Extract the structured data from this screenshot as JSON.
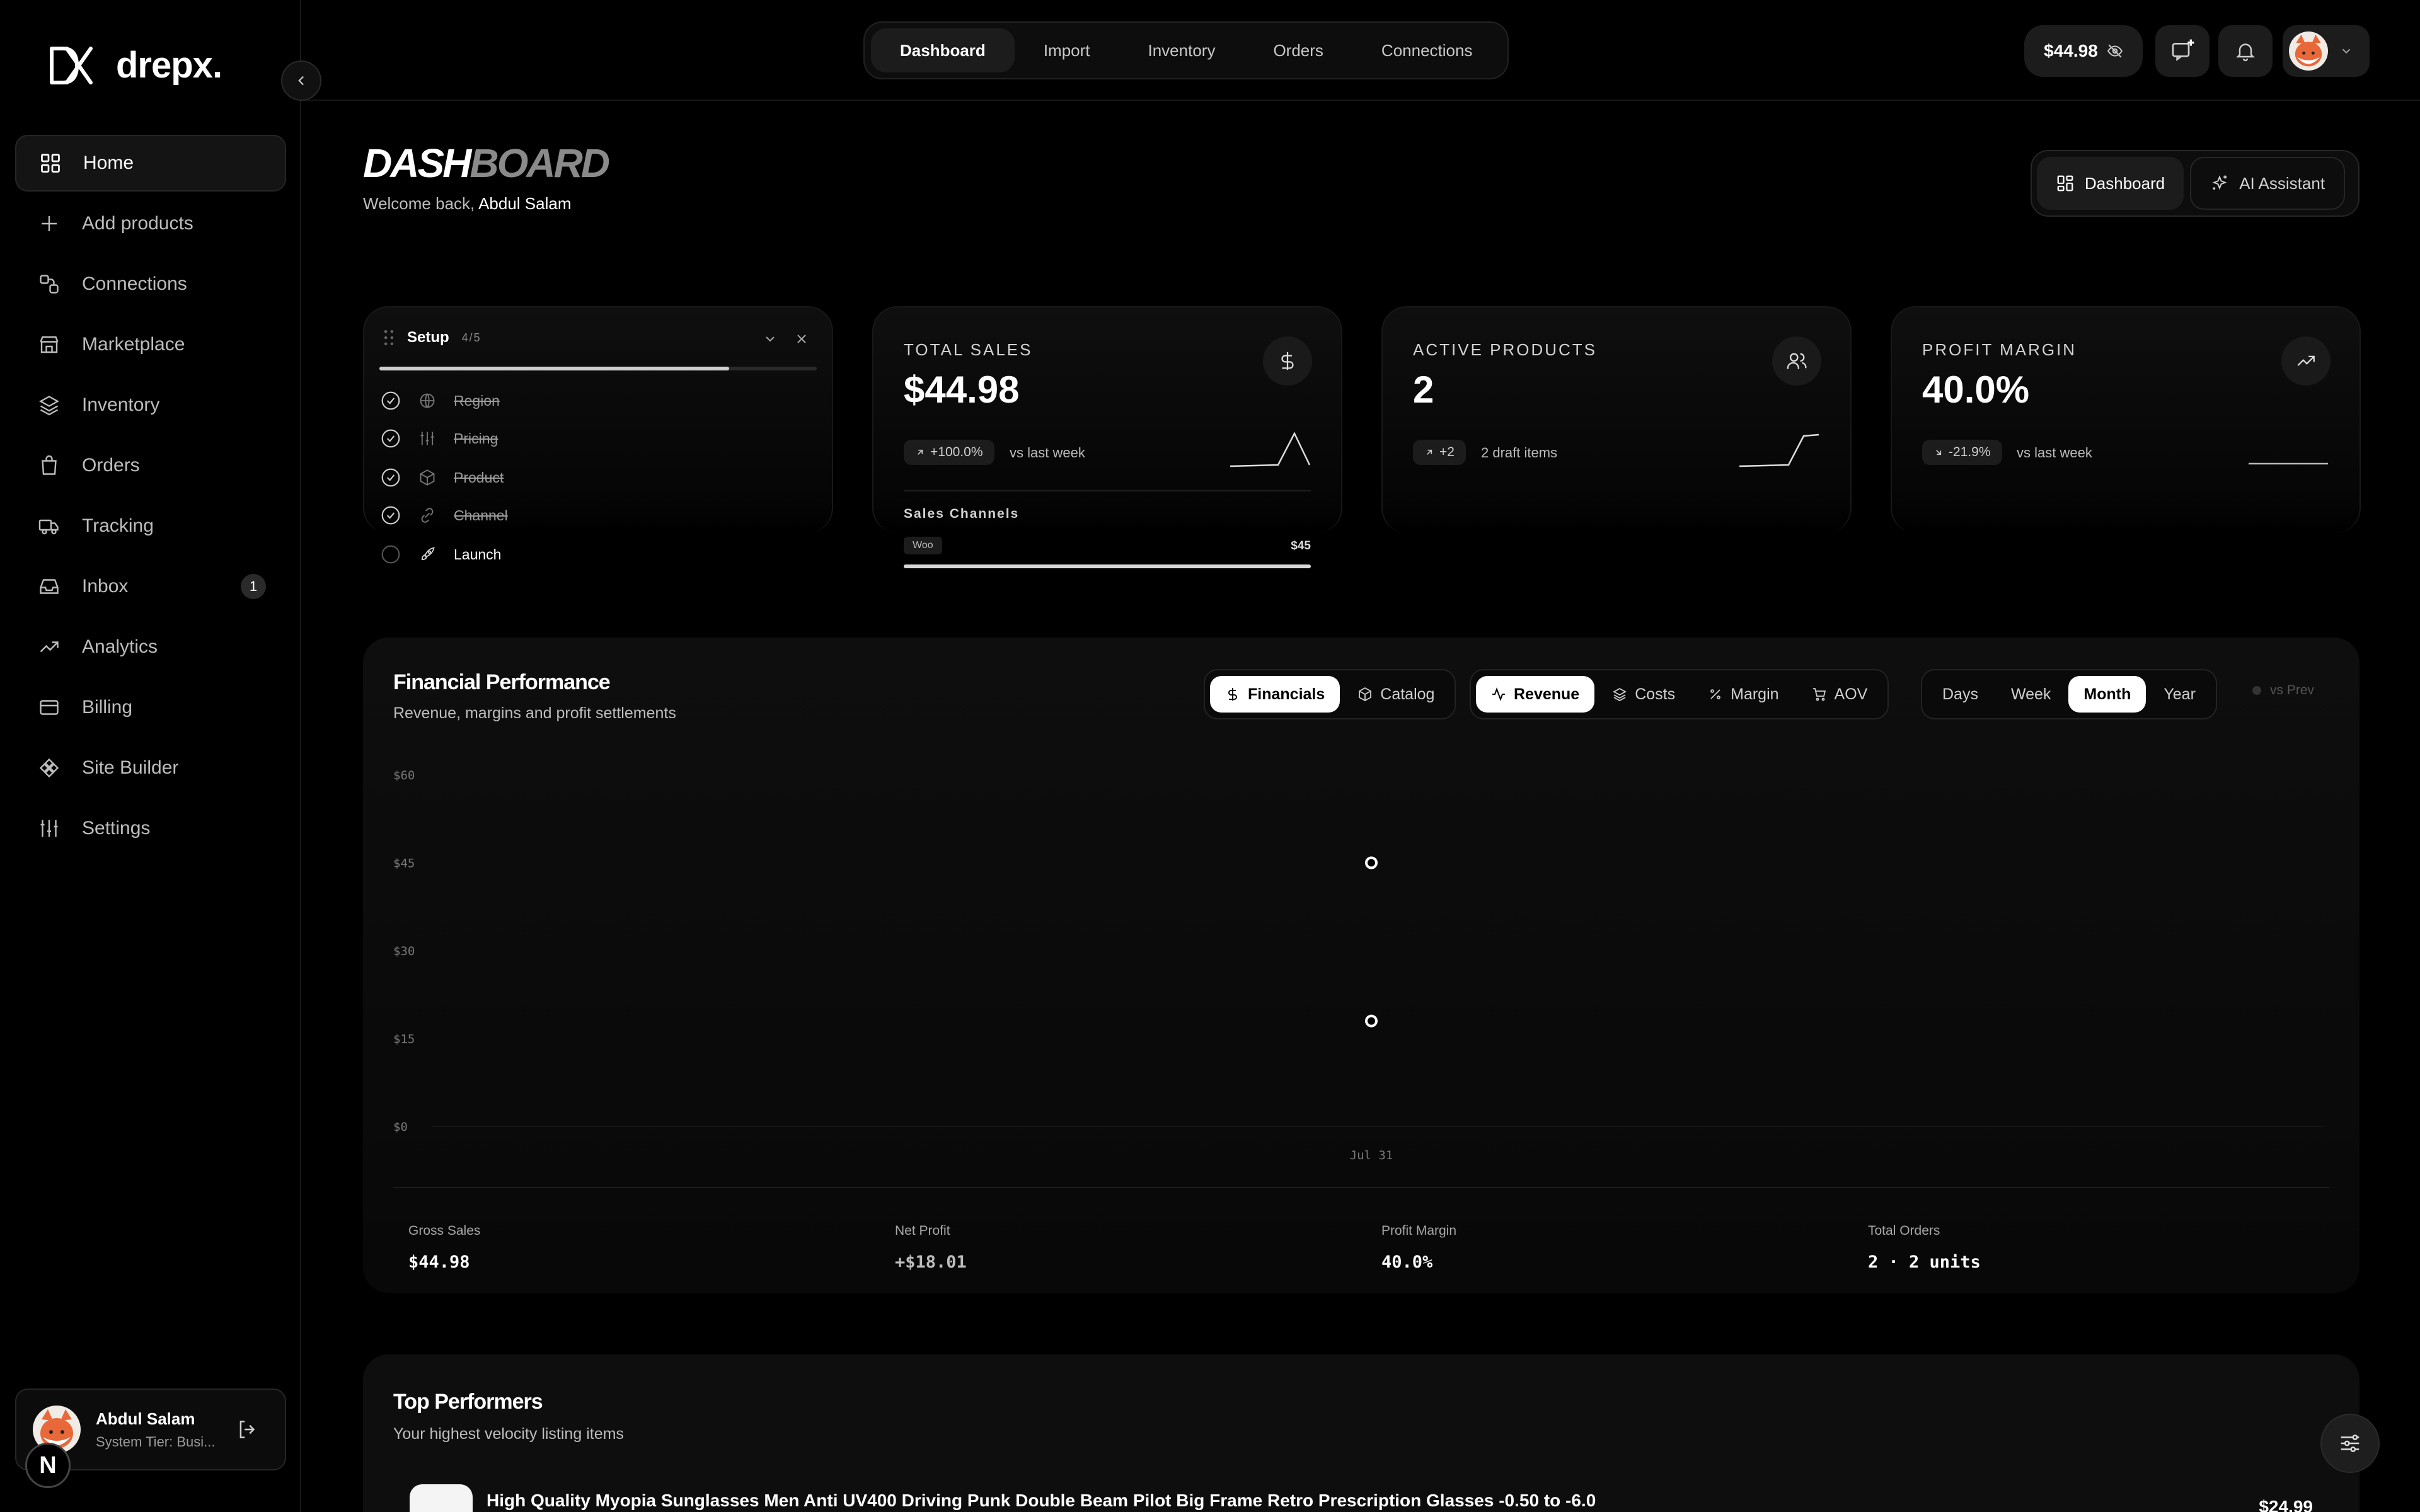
{
  "brand": {
    "logo_text": "drepx."
  },
  "sidebar": {
    "items": [
      {
        "label": "Home",
        "icon": "grid-icon",
        "active": true
      },
      {
        "label": "Add products",
        "icon": "plus-icon"
      },
      {
        "label": "Connections",
        "icon": "connections-icon"
      },
      {
        "label": "Marketplace",
        "icon": "store-icon"
      },
      {
        "label": "Inventory",
        "icon": "layers-icon"
      },
      {
        "label": "Orders",
        "icon": "bag-icon"
      },
      {
        "label": "Tracking",
        "icon": "truck-icon"
      },
      {
        "label": "Inbox",
        "icon": "inbox-icon",
        "badge": "1"
      },
      {
        "label": "Analytics",
        "icon": "trend-icon"
      },
      {
        "label": "Billing",
        "icon": "card-icon"
      },
      {
        "label": "Site Builder",
        "icon": "puzzle-icon"
      },
      {
        "label": "Settings",
        "icon": "sliders-icon"
      }
    ],
    "user": {
      "name": "Abdul Salam",
      "tier": "System Tier: Busi..."
    },
    "n_badge": "N"
  },
  "topbar": {
    "tabs": [
      "Dashboard",
      "Import",
      "Inventory",
      "Orders",
      "Connections"
    ],
    "active_tab": "Dashboard",
    "balance": "$44.98"
  },
  "header": {
    "title_a": "DASH",
    "title_b": "BOARD",
    "welcome": "Welcome back,",
    "user": "Abdul Salam",
    "view_toggle": {
      "dashboard": "Dashboard",
      "assistant": "AI Assistant"
    }
  },
  "setup": {
    "title": "Setup",
    "count": "4/5",
    "progress": 0.8,
    "steps": [
      {
        "label": "Region",
        "done": true,
        "icon": "globe-icon"
      },
      {
        "label": "Pricing",
        "done": true,
        "icon": "sliders-icon"
      },
      {
        "label": "Product",
        "done": true,
        "icon": "box-icon"
      },
      {
        "label": "Channel",
        "done": true,
        "icon": "link-icon"
      },
      {
        "label": "Launch",
        "done": false,
        "icon": "rocket-icon"
      }
    ]
  },
  "stats": {
    "total_sales": {
      "label": "TOTAL SALES",
      "value": "$44.98",
      "delta": "+100.0%",
      "delta_text": "vs last week",
      "channels_label": "Sales Channels",
      "channel_name": "Woo",
      "channel_value": "$45",
      "channel_share": 1.0
    },
    "active_products": {
      "label": "ACTIVE PRODUCTS",
      "value": "2",
      "delta": "+2",
      "delta_text": "2 draft items"
    },
    "profit_margin": {
      "label": "PROFIT MARGIN",
      "value": "40.0%",
      "delta": "-21.9%",
      "delta_text": "vs last week"
    }
  },
  "financial": {
    "title": "Financial Performance",
    "subtitle": "Revenue, margins and profit settlements",
    "view_tabs": [
      "Financials",
      "Catalog"
    ],
    "metric_tabs": [
      "Revenue",
      "Costs",
      "Margin",
      "AOV"
    ],
    "period_tabs": [
      "Days",
      "Week",
      "Month",
      "Year"
    ],
    "active_view": "Financials",
    "active_metric": "Revenue",
    "active_period": "Month",
    "vs_prev": "vs Prev",
    "summary": [
      {
        "label": "Gross Sales",
        "value": "$44.98"
      },
      {
        "label": "Net Profit",
        "value": "+$18.01"
      },
      {
        "label": "Profit Margin",
        "value": "40.0%"
      },
      {
        "label": "Total Orders",
        "value": "2 · 2 units"
      }
    ]
  },
  "chart_data": {
    "type": "scatter",
    "x": [
      "Jul 31"
    ],
    "series": [
      {
        "values": [
          45
        ]
      },
      {
        "values": [
          18
        ]
      }
    ],
    "yticks": [
      "$60",
      "$45",
      "$30",
      "$15",
      "$0"
    ],
    "ylim": [
      0,
      60
    ],
    "grid": false,
    "title": "",
    "xlabel": "",
    "ylabel": ""
  },
  "top_performers": {
    "title": "Top Performers",
    "subtitle": "Your highest velocity listing items",
    "items": [
      {
        "name": "High Quality Myopia Sunglasses Men Anti UV400 Driving Punk Double Beam Pilot Big Frame Retro Prescription Glasses -0.50 to -6.0",
        "price": "$24.99"
      }
    ]
  }
}
